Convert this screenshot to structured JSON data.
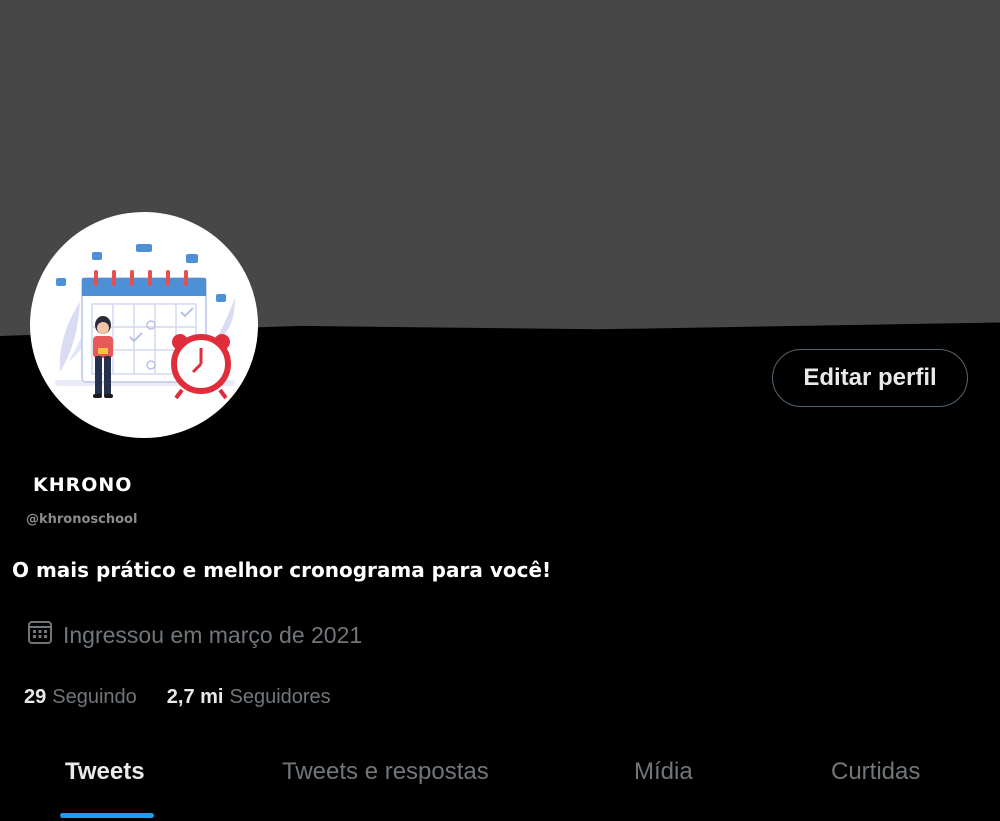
{
  "profile": {
    "display_name": "KHRONO",
    "handle": "@khronoschool",
    "bio": "O mais prático e melhor cronograma para você!",
    "joined": "Ingressou em março de 2021",
    "edit_button": "Editar perfil"
  },
  "stats": {
    "following_count": "29",
    "following_label": "Seguindo",
    "followers_count": "2,7 mi",
    "followers_label": "Seguidores"
  },
  "tabs": [
    {
      "label": "Tweets",
      "active": true
    },
    {
      "label": "Tweets e respostas",
      "active": false
    },
    {
      "label": "Mídia",
      "active": false
    },
    {
      "label": "Curtidas",
      "active": false
    }
  ],
  "icons": {
    "joined": "calendar-icon",
    "avatar": "calendar-alarm-illustration"
  },
  "colors": {
    "banner": "#474747",
    "background": "#000000",
    "accent": "#1d9bf0",
    "muted_text": "#71767b"
  }
}
